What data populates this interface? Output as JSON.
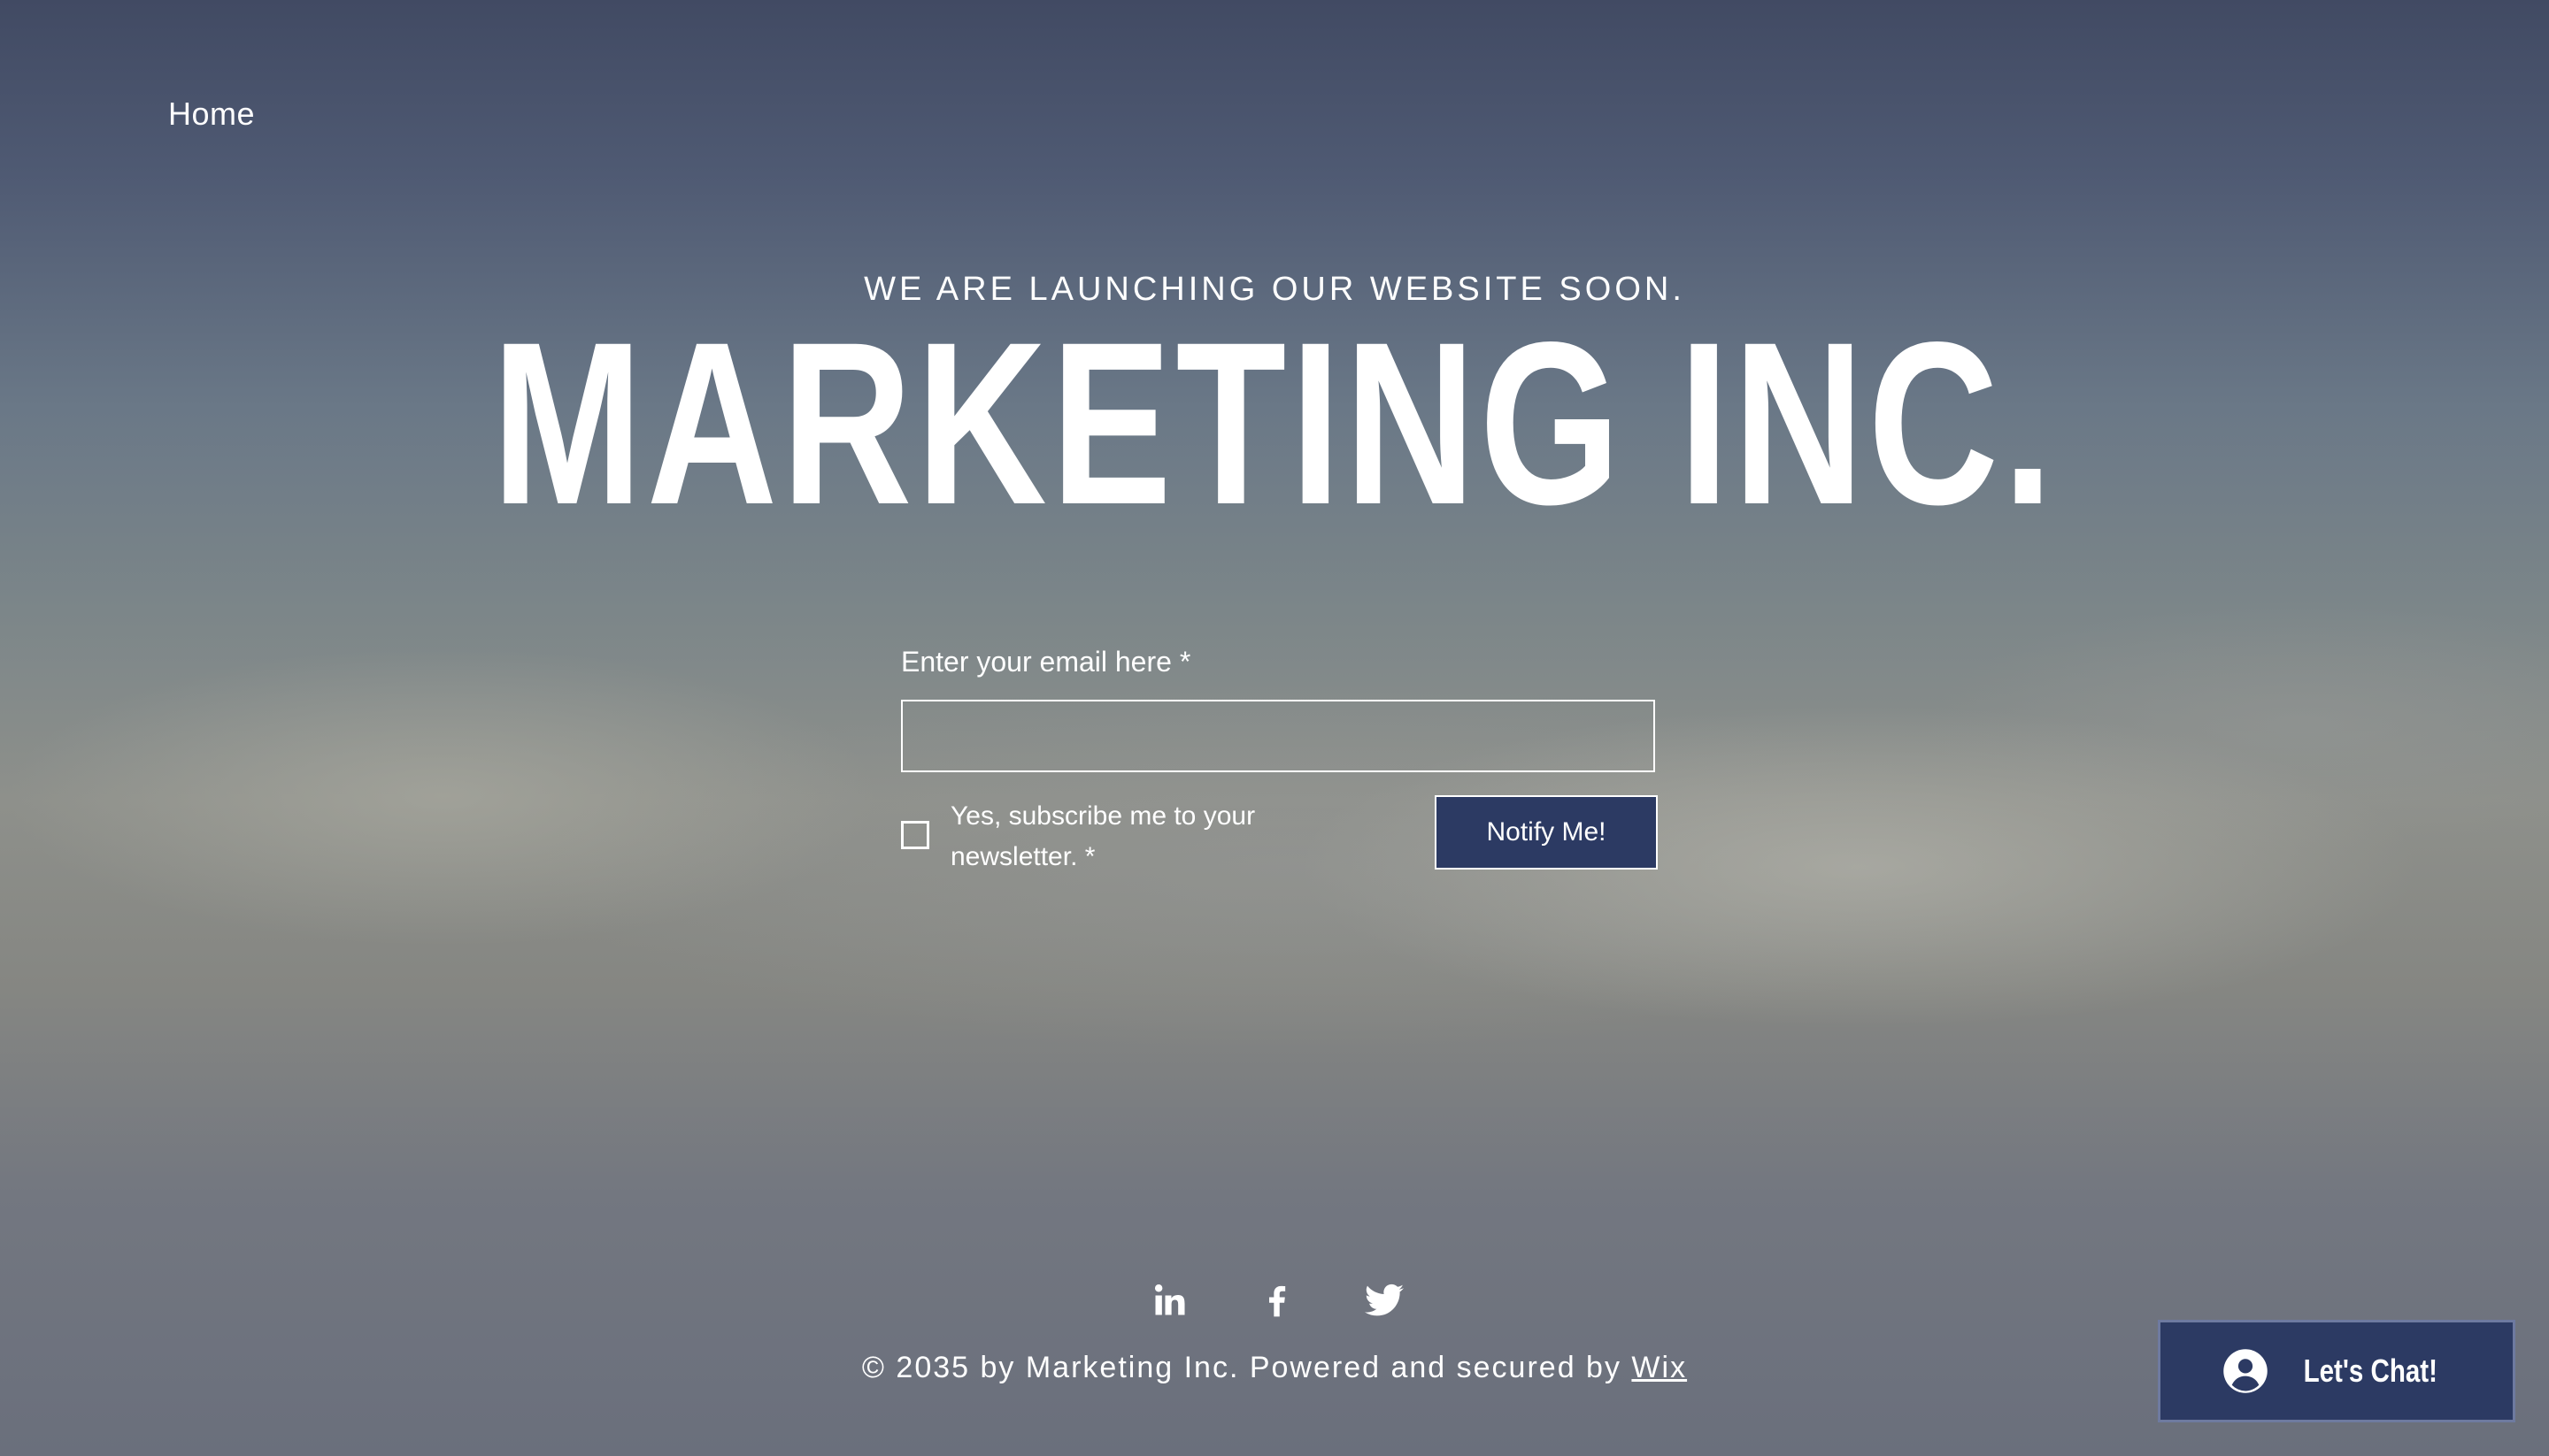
{
  "nav": {
    "home_label": "Home"
  },
  "hero": {
    "eyebrow": "WE ARE LAUNCHING OUR WEBSITE SOON.",
    "title": "MARKETING INC."
  },
  "form": {
    "email_label": "Enter your email here *",
    "email_value": "",
    "newsletter_line1": "Yes, subscribe me to your",
    "newsletter_line2": "newsletter. *",
    "newsletter_checked": false,
    "submit_label": "Notify Me!"
  },
  "social": {
    "icons": [
      "linkedin-icon",
      "facebook-icon",
      "twitter-icon"
    ]
  },
  "footer": {
    "copyright": "© 2035 by Marketing Inc. Powered and secured by",
    "link_label": "Wix"
  },
  "chat": {
    "label": "Let's Chat!",
    "icon": "user-avatar-icon"
  },
  "colors": {
    "button_bg": "#2c3a63",
    "text": "#ffffff"
  }
}
